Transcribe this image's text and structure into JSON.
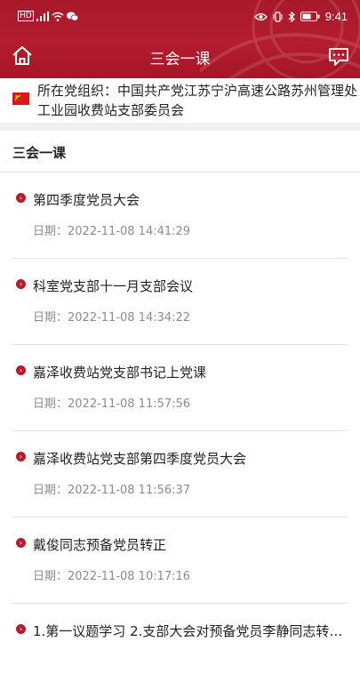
{
  "status_bar": {
    "left_label": "HD",
    "time": "9:41"
  },
  "header": {
    "title": "三会一课"
  },
  "org": {
    "text": "所在党组织：中国共产党江苏宁沪高速公路苏州管理处工业园收费站支部委员会"
  },
  "section": {
    "title": "三会一课"
  },
  "date_prefix": "日期：",
  "items": [
    {
      "title": "第四季度党员大会",
      "date": "日期：2022-11-08 14:41:29"
    },
    {
      "title": "科室党支部十一月支部会议",
      "date": "日期：2022-11-08 14:34:22"
    },
    {
      "title": "嘉泽收费站党支部书记上党课",
      "date": "日期：2022-11-08 11:57:56"
    },
    {
      "title": "嘉泽收费站党支部第四季度党员大会",
      "date": "日期：2022-11-08 11:56:37"
    },
    {
      "title": "戴俊同志预备党员转正",
      "date": "日期：2022-11-08 10:17:16"
    },
    {
      "title": "1.第一议题学习 2.支部大会对预备党员李静同志转…",
      "date": ""
    }
  ],
  "colors": {
    "brand": "#b31d2e",
    "text": "#222222",
    "muted": "#8c8c8c"
  }
}
